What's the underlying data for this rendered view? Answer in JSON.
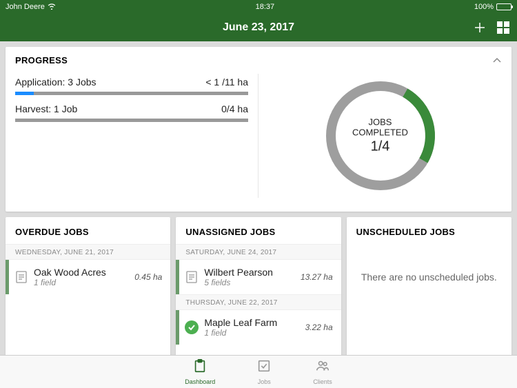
{
  "status": {
    "carrier": "John Deere",
    "time": "18:37",
    "battery_pct": "100%"
  },
  "header": {
    "title": "June 23, 2017"
  },
  "progress": {
    "title": "PROGRESS",
    "items": [
      {
        "label": "Application: 3 Jobs",
        "value": "< 1 /11 ha",
        "fill_pct": 8
      },
      {
        "label": "Harvest: 1 Job",
        "value": "0/4 ha",
        "fill_pct": 0
      }
    ],
    "ring": {
      "line1": "JOBS",
      "line2": "COMPLETED",
      "fraction": "1/4",
      "completed": 1,
      "total": 4
    }
  },
  "columns": {
    "overdue": {
      "title": "OVERDUE JOBS",
      "groups": [
        {
          "date": "WEDNESDAY, JUNE 21, 2017",
          "items": [
            {
              "name": "Oak Wood Acres",
              "sub": "1 field",
              "area": "0.45 ha",
              "status": "doc"
            }
          ]
        }
      ]
    },
    "unassigned": {
      "title": "UNASSIGNED JOBS",
      "groups": [
        {
          "date": "SATURDAY, JUNE 24, 2017",
          "items": [
            {
              "name": "Wilbert Pearson",
              "sub": "5 fields",
              "area": "13.27 ha",
              "status": "doc"
            }
          ]
        },
        {
          "date": "THURSDAY, JUNE 22, 2017",
          "items": [
            {
              "name": "Maple Leaf Farm",
              "sub": "1 field",
              "area": "3.22 ha",
              "status": "done"
            }
          ]
        }
      ]
    },
    "unscheduled": {
      "title": "UNSCHEDULED JOBS",
      "empty_text": "There are no unscheduled jobs."
    }
  },
  "tabs": {
    "dashboard": "Dashboard",
    "jobs": "Jobs",
    "clients": "Clients"
  }
}
